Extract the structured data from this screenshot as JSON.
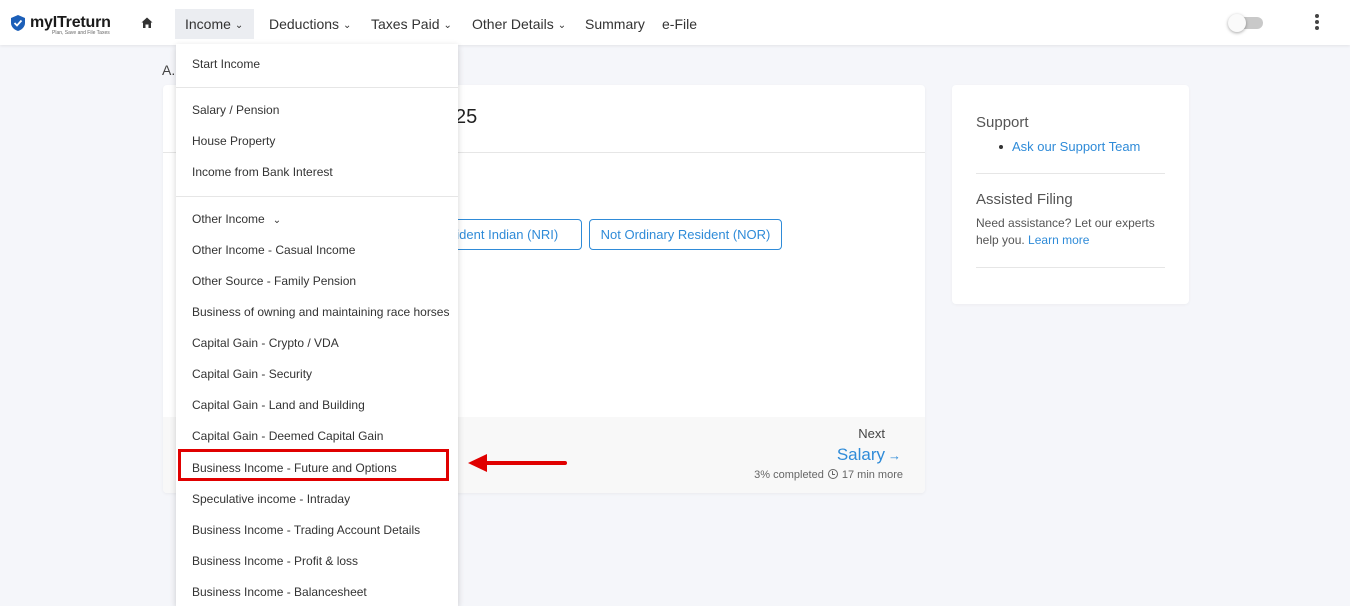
{
  "app": {
    "logo_text": "myITreturn",
    "logo_tagline": "Plan, Save and File Taxes",
    "colors": {
      "accent": "#2f8bd8",
      "highlight": "#e00000"
    }
  },
  "nav": {
    "items": [
      {
        "label": "Income",
        "has_chevron": true,
        "active": true
      },
      {
        "label": "Deductions",
        "has_chevron": true
      },
      {
        "label": "Taxes Paid",
        "has_chevron": true
      },
      {
        "label": "Other Details",
        "has_chevron": true
      },
      {
        "label": "Summary",
        "has_chevron": false
      },
      {
        "label": "e-File",
        "has_chevron": false
      }
    ]
  },
  "income_menu": {
    "items": [
      "Start Income",
      "Salary / Pension",
      "House Property",
      "Income from Bank Interest",
      "Other Income",
      "Other Income - Casual Income",
      "Other Source - Family Pension",
      "Business of owning and maintaining race horses",
      "Capital Gain - Crypto / VDA",
      "Capital Gain - Security",
      "Capital Gain - Land and Building",
      "Capital Gain - Deemed Capital Gain",
      "Business Income - Future and Options",
      "Speculative income - Intraday",
      "Business Income - Trading Account Details",
      "Business Income - Profit & loss",
      "Business Income - Balancesheet"
    ],
    "highlighted_item": "Business Income - Future and Options"
  },
  "main": {
    "ay_label_partial": "A.",
    "title_partial": "25",
    "residency_buttons": [
      "sident Indian (NRI)",
      "Not Ordinary Resident (NOR)"
    ],
    "next_label": "Next",
    "next_link": "Salary",
    "progress_text": "3% completed",
    "time_left": "17 min more"
  },
  "sidebar": {
    "support_title": "Support",
    "support_link": "Ask our Support Team",
    "assisted_title": "Assisted Filing",
    "assisted_text": "Need assistance? Let our experts help you.",
    "learn_more": "Learn more"
  }
}
